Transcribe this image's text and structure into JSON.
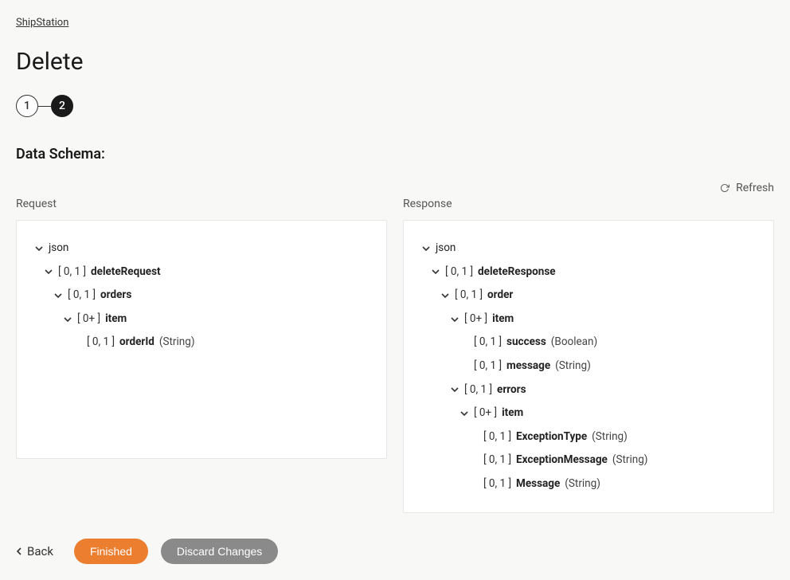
{
  "breadcrumb": "ShipStation",
  "title": "Delete",
  "stepper": {
    "step1": "1",
    "step2": "2"
  },
  "schemaLabel": "Data Schema:",
  "refresh": "Refresh",
  "requestLabel": "Request",
  "responseLabel": "Response",
  "request": {
    "root": "json",
    "n1_card": "[ 0, 1 ]",
    "n1_name": "deleteRequest",
    "n2_card": "[ 0, 1 ]",
    "n2_name": "orders",
    "n3_card": "[ 0+ ]",
    "n3_name": "item",
    "n4_card": "[ 0, 1 ]",
    "n4_name": "orderId",
    "n4_type": "(String)"
  },
  "response": {
    "root": "json",
    "r1_card": "[ 0, 1 ]",
    "r1_name": "deleteResponse",
    "r2_card": "[ 0, 1 ]",
    "r2_name": "order",
    "r3_card": "[ 0+ ]",
    "r3_name": "item",
    "r4_card": "[ 0, 1 ]",
    "r4_name": "success",
    "r4_type": "(Boolean)",
    "r5_card": "[ 0, 1 ]",
    "r5_name": "message",
    "r5_type": "(String)",
    "r6_card": "[ 0, 1 ]",
    "r6_name": "errors",
    "r7_card": "[ 0+ ]",
    "r7_name": "item",
    "r8_card": "[ 0, 1 ]",
    "r8_name": "ExceptionType",
    "r8_type": "(String)",
    "r9_card": "[ 0, 1 ]",
    "r9_name": "ExceptionMessage",
    "r9_type": "(String)",
    "r10_card": "[ 0, 1 ]",
    "r10_name": "Message",
    "r10_type": "(String)"
  },
  "footer": {
    "back": "Back",
    "finished": "Finished",
    "discard": "Discard Changes"
  }
}
